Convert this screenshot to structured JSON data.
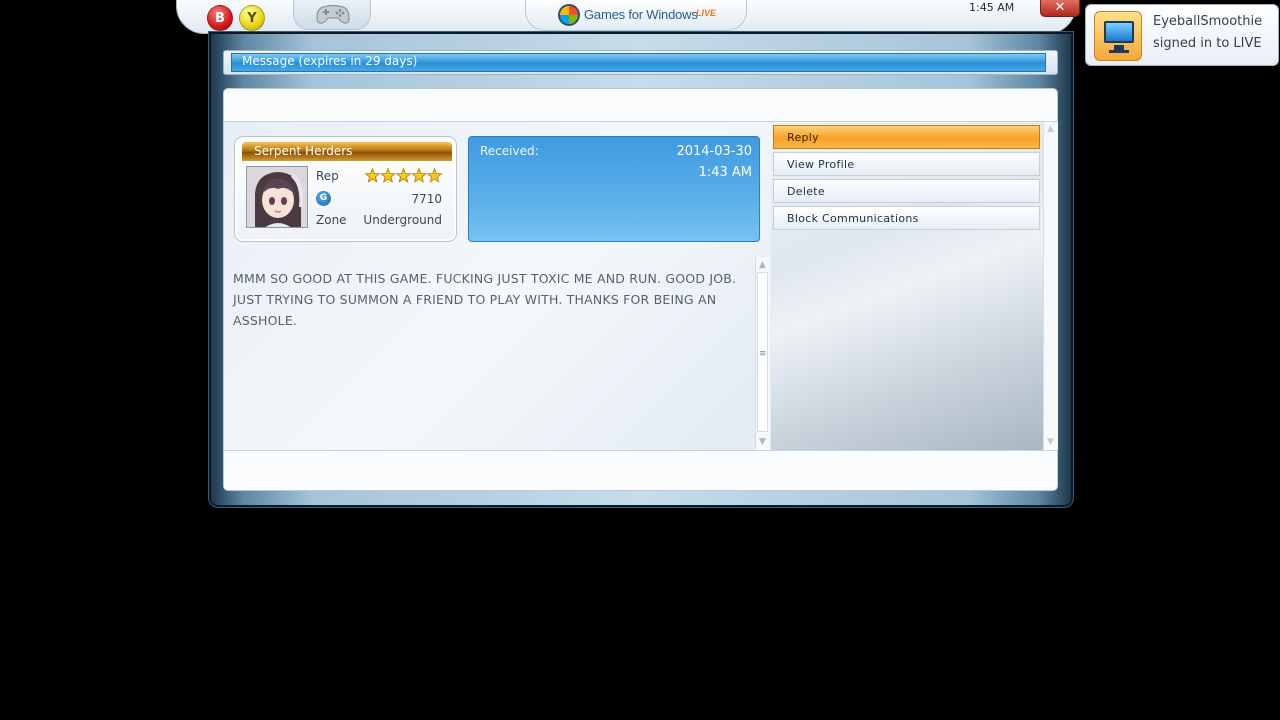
{
  "guide": {
    "b_button": "B",
    "y_button": "Y",
    "controller_icon": "gamepad-icon",
    "brand_text": "Games for Windows",
    "brand_live": "LIVE",
    "clock": "1:45 AM",
    "close_label": "✕"
  },
  "toast": {
    "icon": "monitor-icon",
    "line1": "EyeballSmoothie",
    "line2": "signed in to LIVE"
  },
  "window": {
    "title": "Message (expires in 29 days)"
  },
  "gamercard": {
    "gamertag": "Serpent Herders",
    "rep_label": "Rep",
    "rep_stars": 5,
    "gamerscore_icon": "G",
    "gamerscore": "7710",
    "zone_label": "Zone",
    "zone_value": "Underground"
  },
  "received": {
    "label": "Received:",
    "date": "2014-03-30",
    "time": "1:43 AM"
  },
  "message": {
    "body": "MMM SO GOOD AT THIS GAME. FUCKING JUST TOXIC ME AND RUN. GOOD JOB. JUST TRYING TO SUMMON A FRIEND TO PLAY WITH. THANKS FOR BEING AN ASSHOLE."
  },
  "actions": [
    {
      "label": "Reply",
      "selected": true
    },
    {
      "label": "View Profile",
      "selected": false
    },
    {
      "label": "Delete",
      "selected": false
    },
    {
      "label": "Block Communications",
      "selected": false
    }
  ],
  "colors": {
    "accent_blue": "#3f9be0",
    "selected_orange": "#f6a225",
    "gamertag_gold": "#b4760f"
  }
}
